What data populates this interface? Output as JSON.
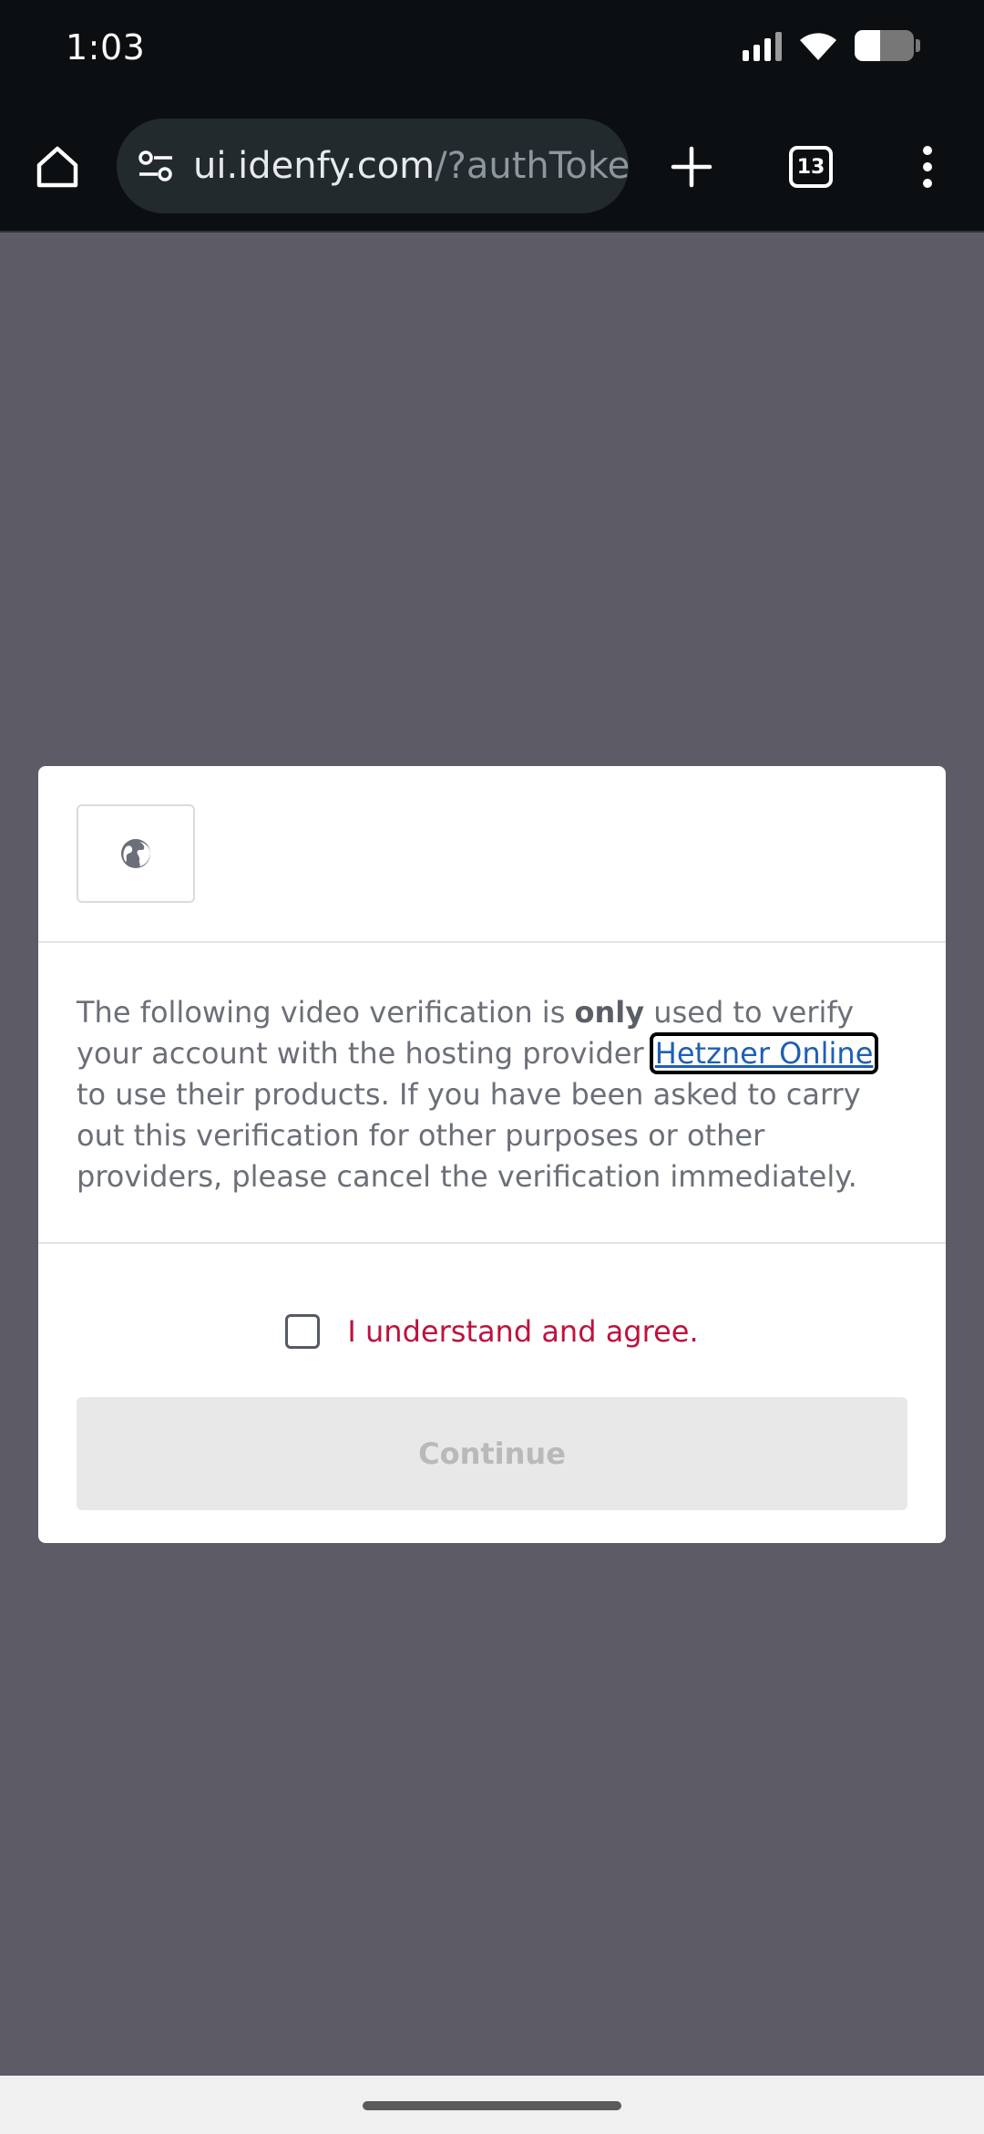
{
  "status_bar": {
    "time": "1:03",
    "icons": [
      "signal-icon",
      "wifi-icon",
      "battery-icon"
    ]
  },
  "browser": {
    "url_host": "ui.idenfy.com",
    "url_rest": "/?authToke",
    "tab_count": "13",
    "icons": [
      "home-icon",
      "tune-icon",
      "plus-icon",
      "tabs-icon",
      "menu-icon"
    ],
    "colors": {
      "toolbar_bg": "#0c0f12",
      "omnibox_bg": "#232a2e"
    }
  },
  "dialog": {
    "language_icon": "globe-icon",
    "notice": {
      "part1": "The following video verification is ",
      "bold": "only",
      "part2": " used to verify your account with the hosting provider ",
      "link": "Hetzner Online",
      "part3": " to use their products. If you have been asked to carry out this verification for other purposes or other providers, please cancel the verification immediately."
    },
    "agree_label": "I understand and agree.",
    "agree_checked": false,
    "continue_label": "Continue",
    "continue_enabled": false,
    "colors": {
      "agree_text": "#be123c",
      "link": "#1f5fb5",
      "overlay": "#5d5b66"
    }
  }
}
